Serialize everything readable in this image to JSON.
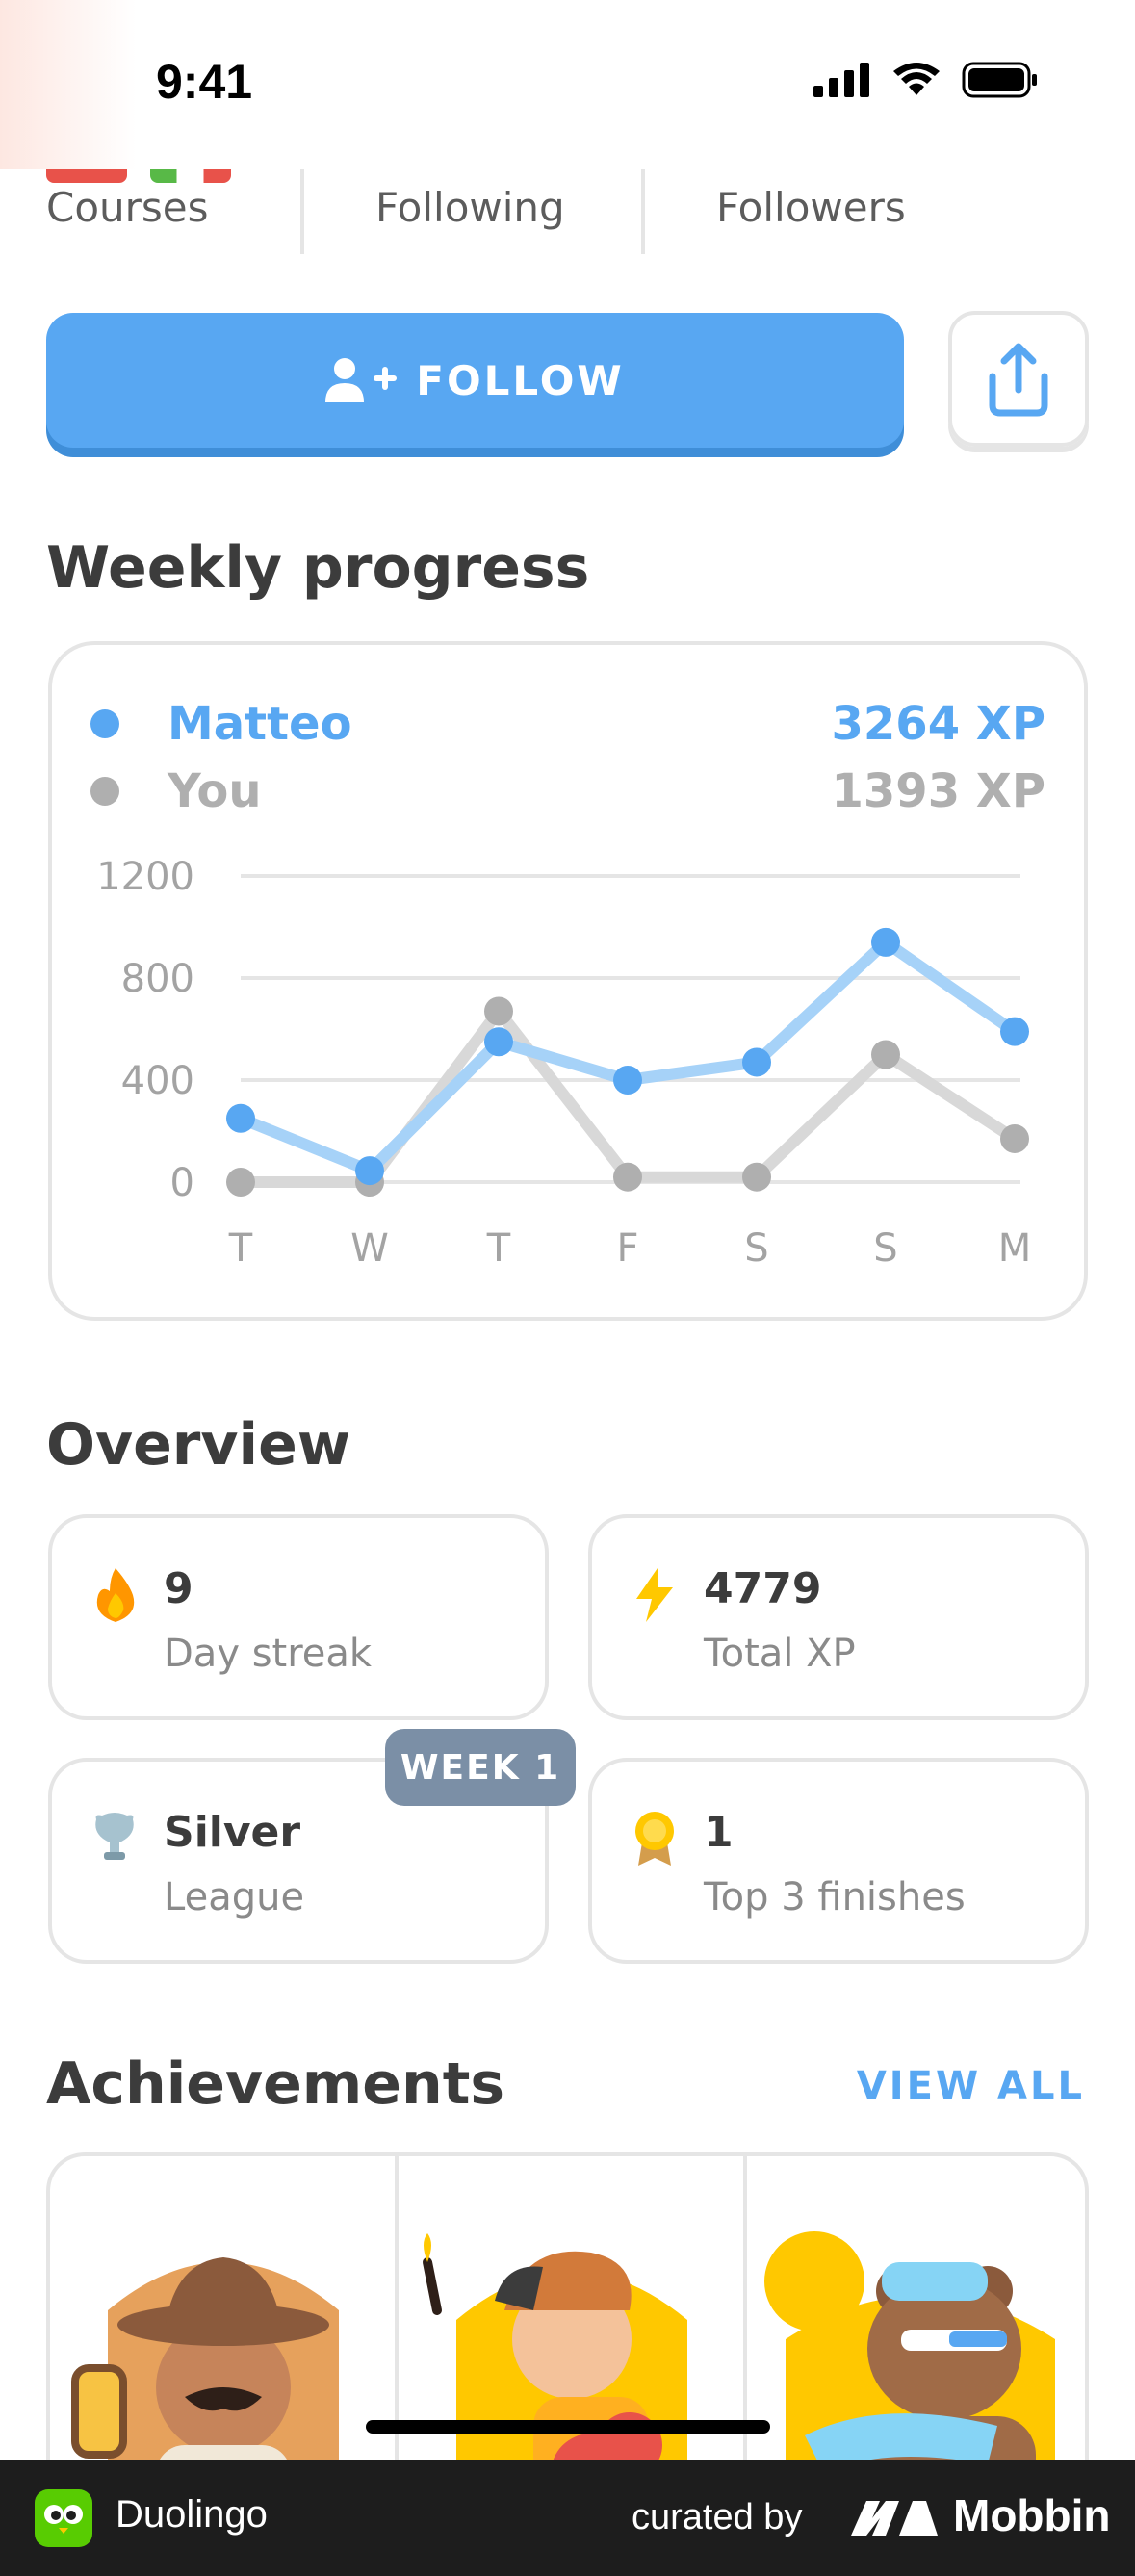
{
  "status_bar": {
    "time": "9:41"
  },
  "stats": {
    "courses_label": "Courses",
    "following_label": "Following",
    "followers_label": "Followers"
  },
  "actions": {
    "follow_label": "FOLLOW"
  },
  "weekly": {
    "title": "Weekly progress",
    "legend": [
      {
        "name": "Matteo",
        "xp": "3264 XP",
        "color": "#58a7f2"
      },
      {
        "name": "You",
        "xp": "1393 XP",
        "color": "#afafaf"
      }
    ]
  },
  "chart_data": {
    "type": "line",
    "categories": [
      "T",
      "W",
      "T",
      "F",
      "S",
      "S",
      "M"
    ],
    "y_ticks": [
      "1200",
      "800",
      "400",
      "0"
    ],
    "ylim": [
      0,
      1200
    ],
    "grid": true,
    "series": [
      {
        "name": "Matteo",
        "color": "#58a7f2",
        "values": [
          250,
          45,
          550,
          400,
          470,
          940,
          590
        ]
      },
      {
        "name": "You",
        "color": "#afafaf",
        "values": [
          0,
          0,
          670,
          20,
          20,
          500,
          170
        ]
      }
    ]
  },
  "overview": {
    "title": "Overview",
    "streak": {
      "value": "9",
      "label": "Day streak"
    },
    "total_xp": {
      "value": "4779",
      "label": "Total XP"
    },
    "league": {
      "value": "Silver",
      "label": "League",
      "badge": "WEEK 1"
    },
    "top3": {
      "value": "1",
      "label": "Top 3 finishes"
    }
  },
  "achievements": {
    "title": "Achievements",
    "view_all": "VIEW ALL"
  },
  "footer": {
    "app_name": "Duolingo",
    "curated_by": "curated by",
    "brand": "Mobbin"
  }
}
